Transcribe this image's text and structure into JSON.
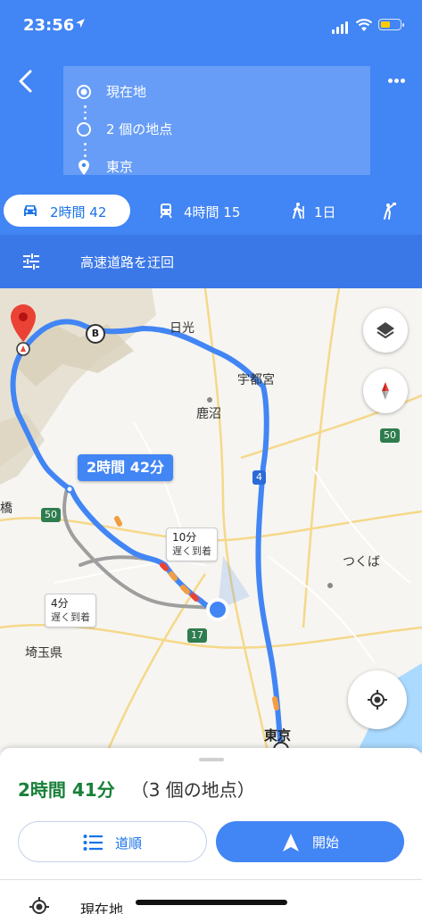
{
  "status_bar": {
    "time": "23:56"
  },
  "directions": {
    "stops": [
      {
        "label": "現在地",
        "icon": "origin-circle-icon"
      },
      {
        "label": "2 個の地点",
        "icon": "waypoint-circle-icon"
      },
      {
        "label": "東京",
        "icon": "destination-pin-icon"
      }
    ]
  },
  "modes": [
    {
      "label": "2時間 42",
      "icon": "car-icon",
      "active": true
    },
    {
      "label": "4時間 15",
      "icon": "train-icon",
      "active": false
    },
    {
      "label": "1日",
      "icon": "walk-icon",
      "active": false
    },
    {
      "label": "",
      "icon": "ride-hail-icon",
      "active": false
    }
  ],
  "options": {
    "label": "高速道路を迂回",
    "icon": "tune-icon"
  },
  "map": {
    "route_time": "2時間 42分",
    "waypoint_marker": "B",
    "places": {
      "nikko": "日光",
      "utsunomiya": "宇都宮",
      "kanuma": "鹿沼",
      "tsukuba": "つくば",
      "saitama": "埼玉県",
      "tokyo": "東京",
      "partial": "橋"
    },
    "route_shields": [
      "50",
      "4",
      "50",
      "17"
    ],
    "alternatives": [
      {
        "time": "10分",
        "note": "遅く到着"
      },
      {
        "time": "4分",
        "note": "遅く到着"
      }
    ],
    "colors": {
      "route_primary": "#4285f4",
      "route_alternative": "#9e9e9e",
      "destination_pin": "#ea4335"
    }
  },
  "sheet": {
    "duration": "2時間 41分",
    "stops_count": "（3 個の地点）",
    "steps_label": "道順",
    "start_label": "開始",
    "first_step": "現在地"
  }
}
